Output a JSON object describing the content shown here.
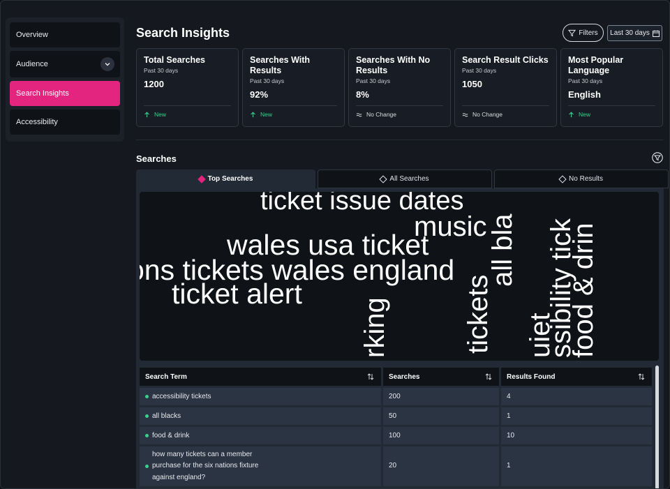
{
  "sidebar": {
    "items": [
      {
        "label": "Overview"
      },
      {
        "label": "Audience"
      },
      {
        "label": "Search Insights"
      },
      {
        "label": "Accessibility"
      }
    ]
  },
  "header": {
    "title": "Search Insights",
    "filters_label": "Filters",
    "date_range_label": "Last 30 days"
  },
  "cards": [
    {
      "title": "Total Searches",
      "sub": "Past 30 days",
      "value": "1200",
      "trend": "New",
      "trend_icon": "arrow-up-icon"
    },
    {
      "title": "Searches With Results",
      "sub": "Past 30 days",
      "value": "92%",
      "trend": "New",
      "trend_icon": "arrow-up-icon"
    },
    {
      "title": "Searches With No Results",
      "sub": "Past 30 days",
      "value": "8%",
      "trend": "No Change",
      "trend_icon": "approx-equal-icon"
    },
    {
      "title": "Search Result Clicks",
      "sub": "Past 30 days",
      "value": "1050",
      "trend": "No Change",
      "trend_icon": "approx-equal-icon"
    },
    {
      "title": "Most Popular Language",
      "sub": "Past 30 days",
      "value": "English",
      "trend": "New",
      "trend_icon": "arrow-up-icon"
    }
  ],
  "searches": {
    "title": "Searches",
    "tabs": [
      {
        "label": "Top Searches",
        "active": true
      },
      {
        "label": "All Searches",
        "active": false
      },
      {
        "label": "No Results",
        "active": false
      }
    ],
    "word_cloud": [
      "ticket issue dates",
      "music",
      "wales usa ticket",
      "ons tickets wales england",
      "ticket alert",
      "rking",
      "tickets",
      "all bla",
      "uiet",
      "ssibility tick",
      "food & drin"
    ],
    "table": {
      "headers": [
        "Search Term",
        "Searches",
        "Results Found"
      ],
      "rows": [
        {
          "term": "accessibility tickets",
          "searches": "200",
          "results": "4"
        },
        {
          "term": "all blacks",
          "searches": "50",
          "results": "1"
        },
        {
          "term": "food & drink",
          "searches": "100",
          "results": "10"
        },
        {
          "term_lines": [
            "how many tickets can a member",
            "purchase for the six nations fixture",
            "against england?"
          ],
          "searches": "20",
          "results": "1"
        }
      ]
    }
  },
  "colors": {
    "accent": "#e3257f",
    "positive": "#3ccf8e",
    "background": "#15191f"
  }
}
